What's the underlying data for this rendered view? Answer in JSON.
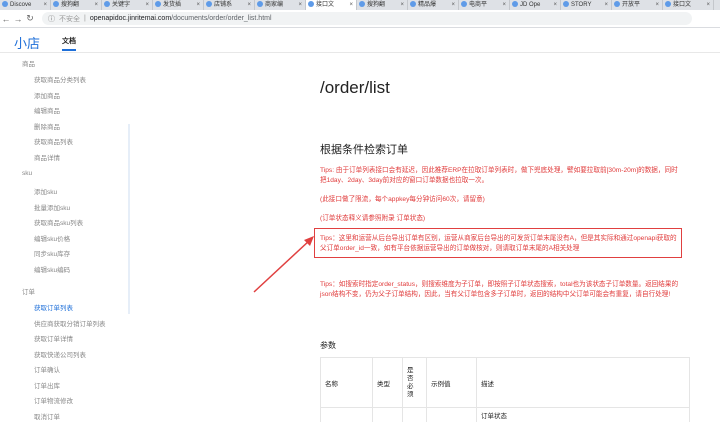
{
  "browser": {
    "tabs": [
      {
        "label": "Discove"
      },
      {
        "label": "搜狗翻"
      },
      {
        "label": "关键字"
      },
      {
        "label": "发货插"
      },
      {
        "label": "店铺系"
      },
      {
        "label": "商家编"
      },
      {
        "label": "接口文"
      },
      {
        "label": "搜狗翻"
      },
      {
        "label": "精品爆"
      },
      {
        "label": "电商平"
      },
      {
        "label": "JD Ope"
      },
      {
        "label": "STORY"
      },
      {
        "label": "开放平"
      },
      {
        "label": "接口文"
      }
    ],
    "security": "不安全",
    "url_host": "openapidoc.jinritemai.com",
    "url_path": "/documents/order/order_list.html"
  },
  "header": {
    "brand": "小店",
    "doc_tab": "文档"
  },
  "sidebar": {
    "groups": [
      {
        "label": "商品",
        "items": [
          "获取商品分类列表",
          "添加商品",
          "编辑商品",
          "删除商品",
          "获取商品列表",
          "商品详情"
        ]
      },
      {
        "label": "sku",
        "items": [
          "添加sku",
          "批量添加sku",
          "获取商品sku列表",
          "编辑sku价格",
          "同步sku库存",
          "编辑sku编码"
        ]
      },
      {
        "label": "订单",
        "items": [
          "获取订单列表",
          "供应商获取分销订单列表",
          "获取订单详情",
          "获取快递公司列表",
          "订单确认",
          "订单出库",
          "订单物流修改",
          "取消订单"
        ]
      }
    ],
    "active_item": "获取订单列表"
  },
  "main": {
    "title": "/order/list",
    "section_title": "根据条件检索订单",
    "tips1": "Tips: 由于订单列表接口会有延迟，因此推荐ERP在拉取订单列表时，做下兜底处理，譬如要拉取前[30m-20m]的数据，同时把1day、2day、3day前对应的窗口订单数据也拉取一次。",
    "tips2": "(此接口做了限流，每个appkey每分钟访问60次，请留意)",
    "tips3": "(订单状态释义请参照附录 订单状态)",
    "tips4": "Tips：这里和运营从后台导出订单有区别，运营从商家后台导出的可发货订单末尾没有A，但是其实际和通过openapi获取的父订单order_id一致，如有平台依据运营导出的订单做核对，则请取订单末尾的A相关处理",
    "tips5": "Tips：如搜索时指定order_status，则搜索维度为子订单，即按照子订单状态搜索，total也为该状态子订单数量。返回结果的json结构不变，仍为父子订单结构，因此，当有父订单包含多子订单时，返回的结构中父订单可能会有重复，请自行处理!",
    "params_label": "参数",
    "table_headers": [
      "名称",
      "类型",
      "是否必须",
      "示例值",
      "描述"
    ],
    "first_row_desc": "订单状态"
  }
}
